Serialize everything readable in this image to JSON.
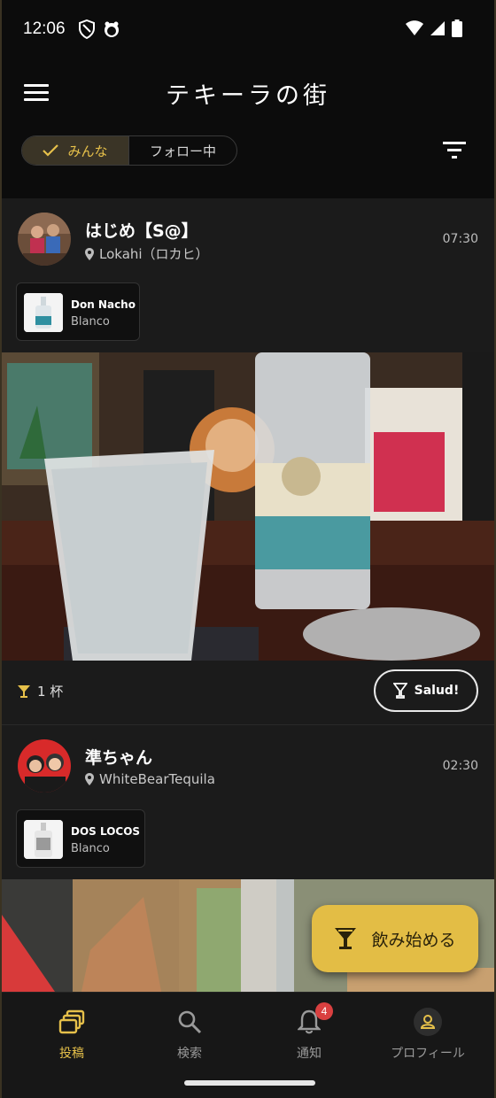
{
  "status_bar": {
    "time": "12:06"
  },
  "header": {
    "title": "テキーラの街"
  },
  "filter": {
    "options": [
      "みんな",
      "フォロー中"
    ],
    "selected": "みんな"
  },
  "posts": [
    {
      "user": "はじめ【S@】",
      "location": "Lokahi（ロカヒ）",
      "time": "07:30",
      "bottle": {
        "brand": "Don Nacho",
        "type": "Blanco"
      },
      "cup_count": "1 杯",
      "salud_label": "Salud!"
    },
    {
      "user": "準ちゃん",
      "location": "WhiteBearTequila",
      "time": "02:30",
      "bottle": {
        "brand": "DOS LOCOS",
        "type": "Blanco"
      }
    }
  ],
  "fab": {
    "label": "飲み始める"
  },
  "bottom_nav": {
    "items": [
      {
        "label": "投稿",
        "icon": "posts-icon"
      },
      {
        "label": "検索",
        "icon": "search-icon"
      },
      {
        "label": "通知",
        "icon": "bell-icon",
        "badge": "4"
      },
      {
        "label": "プロフィール",
        "icon": "profile-icon"
      }
    ],
    "active": "投稿"
  },
  "colors": {
    "accent": "#e3bd45",
    "background": "#0f0f0f",
    "card": "#1b1b1b"
  }
}
